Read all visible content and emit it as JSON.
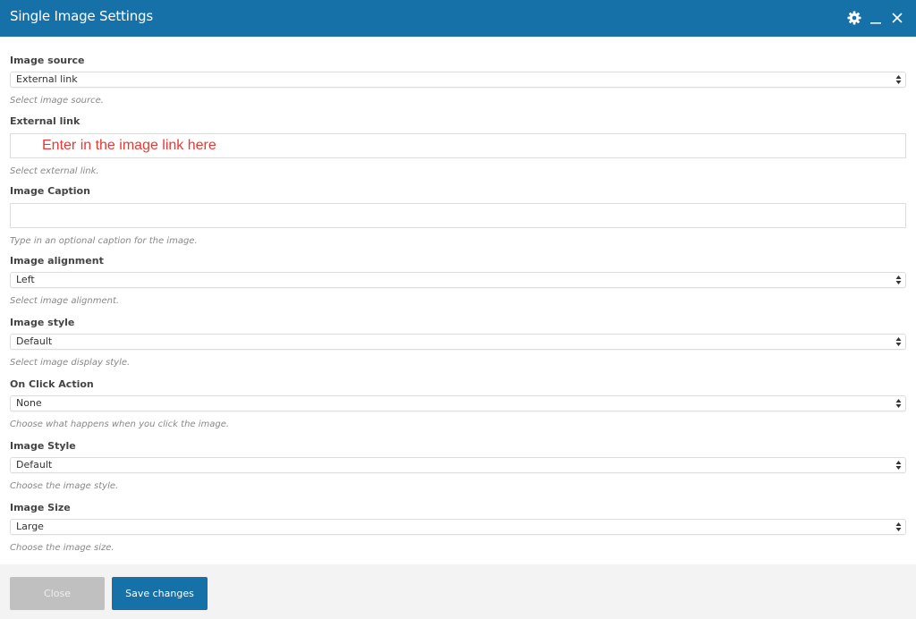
{
  "window": {
    "title": "Single Image Settings",
    "controls": [
      {
        "name": "settings",
        "icon": "gear-icon"
      },
      {
        "name": "minimize",
        "icon": "minimize-icon"
      },
      {
        "name": "close",
        "icon": "close-icon"
      }
    ]
  },
  "fields": [
    {
      "label": "Image source",
      "type": "select",
      "value": "External link",
      "hint": "Select image source."
    },
    {
      "label": "External link",
      "type": "input",
      "value": "",
      "placeholder": "Enter in the image link here",
      "hint": "Select external link."
    },
    {
      "label": "Image Caption",
      "type": "input",
      "value": "",
      "placeholder": "",
      "hint": "Type in an optional caption for the image."
    },
    {
      "label": "Image alignment",
      "type": "select",
      "value": "Left",
      "hint": "Select image alignment."
    },
    {
      "label": "Image style",
      "type": "select",
      "value": "Default",
      "hint": "Select image display style."
    },
    {
      "label": "On Click Action",
      "type": "select",
      "value": "None",
      "hint": "Choose what happens when you click the image."
    },
    {
      "label": "Image Style",
      "type": "select",
      "value": "Default",
      "hint": "Choose the image style."
    },
    {
      "label": "Image Size",
      "type": "select",
      "value": "Large",
      "hint": "Choose the image size."
    }
  ],
  "footer": {
    "close_label": "Close",
    "save_label": "Save changes"
  },
  "colors": {
    "header_bg": "#1571a7",
    "primary_button": "#1571a7",
    "disabled_button": "#c0c0c0",
    "placeholder_text": "#e53935"
  }
}
